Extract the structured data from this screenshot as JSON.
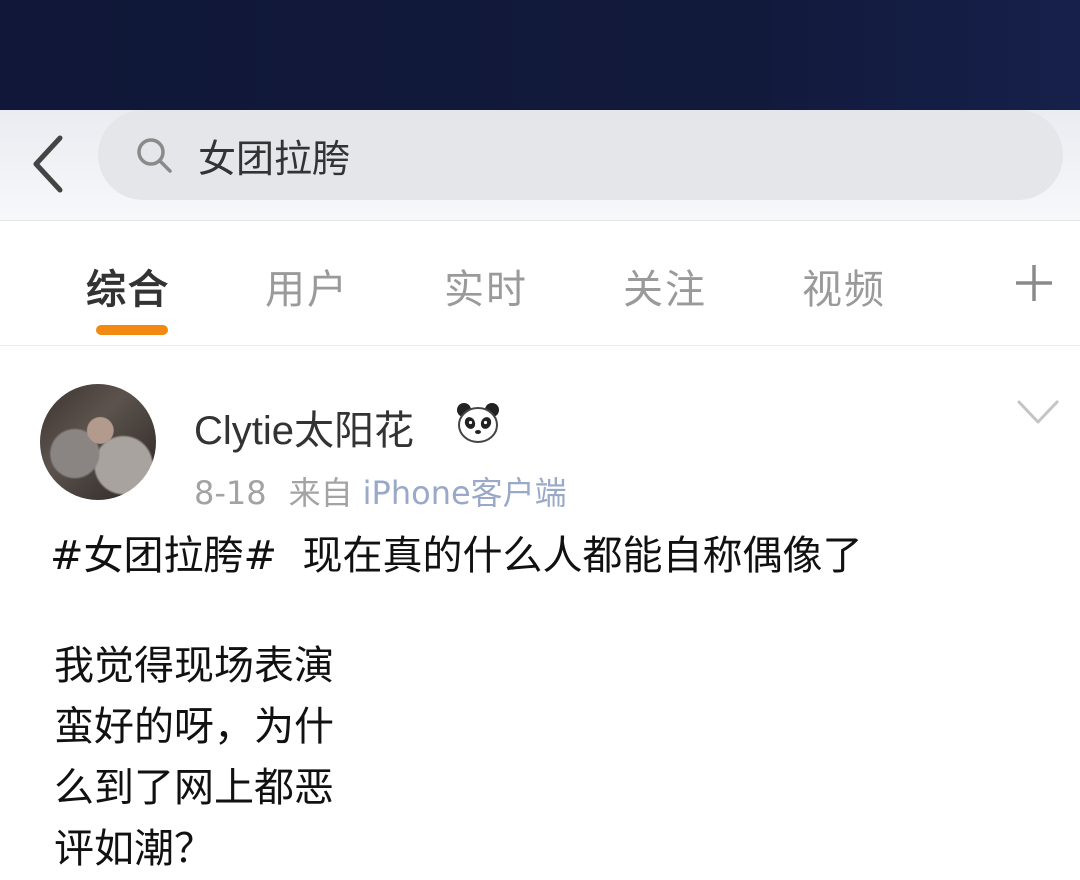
{
  "search": {
    "query": "女团拉胯"
  },
  "tabs": [
    {
      "label": "综合",
      "active": true
    },
    {
      "label": "用户",
      "active": false
    },
    {
      "label": "实时",
      "active": false
    },
    {
      "label": "关注",
      "active": false
    },
    {
      "label": "视频",
      "active": false
    }
  ],
  "post": {
    "username": "Clytie太阳花",
    "date": "8-18",
    "source_prefix": "来自",
    "source": "iPhone客户端",
    "hashtag": "#女团拉胯#",
    "headline": "现在真的什么人都能自称偶像了",
    "body_lines": [
      "我觉得现场表演",
      "蛮好的呀，为什",
      "么到了网上都恶",
      "评如潮？"
    ]
  },
  "colors": {
    "accent": "#f28a12",
    "status_band": "#121a3c",
    "source_link": "#9aa9c8"
  },
  "icons": [
    "back-arrow-icon",
    "search-icon",
    "plus-icon",
    "panda-icon",
    "chevron-down-icon"
  ]
}
